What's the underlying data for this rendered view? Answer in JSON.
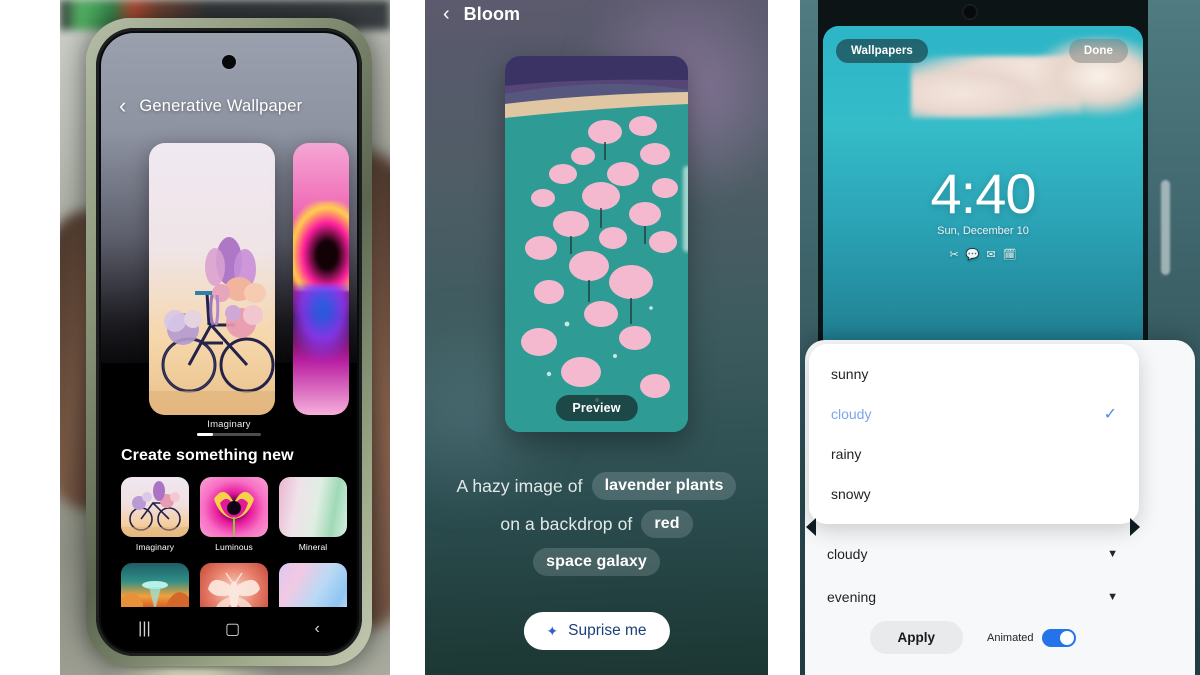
{
  "panels": {
    "generative_wallpaper": {
      "header": {
        "back_icon": "‹",
        "title": "Generative Wallpaper"
      },
      "carousel": {
        "current_label": "Imaginary",
        "page_indicator": "1 of 4"
      },
      "section_title": "Create something new",
      "styles": [
        {
          "label": "Imaginary",
          "swatch": "th-imaginary"
        },
        {
          "label": "Luminous",
          "swatch": "th-luminous"
        },
        {
          "label": "Mineral",
          "swatch": "th-mineral"
        },
        {
          "label": "",
          "swatch": "th-canyon"
        },
        {
          "label": "",
          "swatch": "th-moth"
        },
        {
          "label": "",
          "swatch": "th-silk"
        }
      ],
      "navbar": {
        "recents": "|||",
        "home": "▢",
        "back": "‹"
      }
    },
    "bloom": {
      "header": {
        "back_icon": "‹",
        "title": "Bloom"
      },
      "preview_button": "Preview",
      "prompt": {
        "line1_prefix": "A hazy image of",
        "line1_chip": "lavender plants",
        "line2_prefix": "on a backdrop of",
        "line2_chip": "red",
        "line3_chip": "space galaxy"
      },
      "surprise_button": {
        "icon": "✦",
        "label": "Suprise me"
      }
    },
    "lockscreen": {
      "wallpapers_button": "Wallpapers",
      "done_button": "Done",
      "clock": "4:40",
      "date": "Sun, December 10",
      "notification_icons": [
        "scissors-icon",
        "message-icon",
        "mail-icon",
        "calendar-icon"
      ],
      "dropdown": {
        "options": [
          {
            "label": "sunny",
            "selected": false
          },
          {
            "label": "cloudy",
            "selected": true
          },
          {
            "label": "rainy",
            "selected": false
          },
          {
            "label": "snowy",
            "selected": false
          }
        ],
        "check_glyph": "✓"
      },
      "selects": [
        {
          "value": "cloudy",
          "caret": "▼"
        },
        {
          "value": "evening",
          "caret": "▼"
        }
      ],
      "apply_button": "Apply",
      "animated_label": "Animated",
      "animated_on": true
    }
  },
  "colors": {
    "accent_blue": "#2573e8",
    "selected_option": "#7ba7e8",
    "check_blue": "#4b8ee0",
    "surprise_text": "#1c3f78"
  }
}
